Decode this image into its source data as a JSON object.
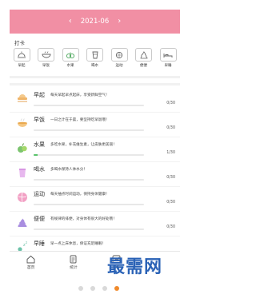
{
  "header": {
    "prev_arrow": "‹",
    "month": "2021-06",
    "next_arrow": "›"
  },
  "section_title": "打卡",
  "categories": [
    {
      "label": "早起",
      "icon": "sunrise-icon"
    },
    {
      "label": "早饭",
      "icon": "bowl-icon"
    },
    {
      "label": "水果",
      "icon": "fruit-icon"
    },
    {
      "label": "喝水",
      "icon": "cup-icon"
    },
    {
      "label": "运动",
      "icon": "sport-icon"
    },
    {
      "label": "便便",
      "icon": "poop-icon"
    },
    {
      "label": "早睡",
      "icon": "sleep-icon"
    }
  ],
  "items": [
    {
      "title": "早起",
      "desc": "每天早起早点起床，享受新鲜空气！",
      "count": "0/30",
      "progress": 0,
      "icon": "sunrise-icon"
    },
    {
      "title": "早饭",
      "desc": "一日之计在于晨，要坚持吃早饭哦！",
      "count": "0/30",
      "progress": 0,
      "icon": "bowl-icon"
    },
    {
      "title": "水果",
      "desc": "多吃水果，补充维生素，让皮肤更美丽！",
      "count": "1/30",
      "progress": 0.0333,
      "icon": "fruit-icon"
    },
    {
      "title": "喝水",
      "desc": "多喝水保持人体水分！",
      "count": "0/30",
      "progress": 0,
      "icon": "cup-icon"
    },
    {
      "title": "运动",
      "desc": "每天抽点时间运动，保持身体健康！",
      "count": "0/30",
      "progress": 0,
      "icon": "sport-icon"
    },
    {
      "title": "便便",
      "desc": "有规律的排便，对身体有很大的好处哦！",
      "count": "0/30",
      "progress": 0,
      "icon": "poop-icon"
    },
    {
      "title": "早睡",
      "desc": "早一点上床休息，保证充足睡眠！",
      "count": "",
      "progress": 0,
      "icon": "sleep-icon"
    }
  ],
  "tabs": [
    {
      "label": "首页",
      "icon": "home-icon"
    },
    {
      "label": "统计",
      "icon": "stats-icon"
    },
    {
      "label": "分析",
      "icon": "analysis-icon"
    },
    {
      "label": "",
      "icon": "profile-icon"
    }
  ],
  "watermark": "最需网",
  "pager": {
    "count": 4,
    "active": 3
  },
  "colors": {
    "header": "#f18fa4",
    "progress": "#59c36a",
    "active_dot": "#f08a2c"
  }
}
